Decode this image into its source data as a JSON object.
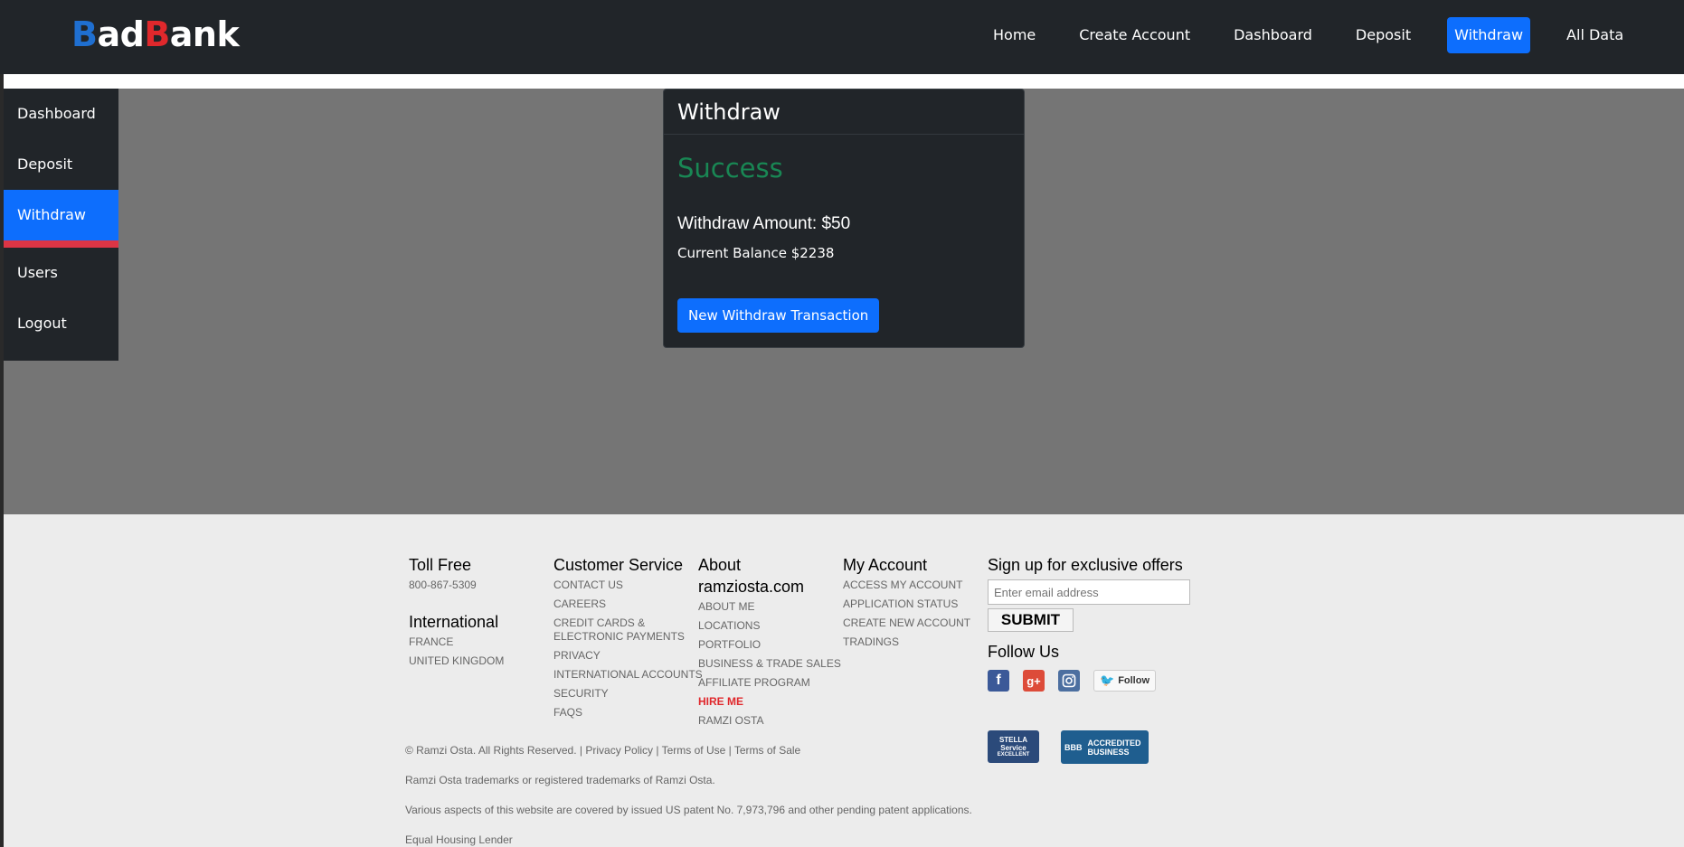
{
  "navbar": {
    "brand": {
      "part1": "B",
      "part2": "ad",
      "part3": "B",
      "part4": "ank"
    },
    "links": [
      "Home",
      "Create Account",
      "Dashboard",
      "Deposit",
      "Withdraw",
      "All Data"
    ],
    "active": "Withdraw"
  },
  "sidebar": {
    "items": [
      "Dashboard",
      "Deposit",
      "Withdraw",
      "Users",
      "Logout"
    ],
    "active": "Withdraw"
  },
  "card": {
    "title": "Withdraw",
    "status": "Success",
    "amount_text": "Withdraw Amount: $50",
    "balance_text": "Current Balance $2238",
    "button": "New Withdraw Transaction"
  },
  "footer": {
    "toll_free": {
      "heading": "Toll Free",
      "phone": "800-867-5309"
    },
    "international": {
      "heading": "International",
      "links": [
        "FRANCE",
        "UNITED KINGDOM"
      ]
    },
    "customer_service": {
      "heading": "Customer Service",
      "links": [
        "CONTACT US",
        "CAREERS",
        "CREDIT CARDS &",
        "ELECTRONIC PAYMENTS",
        "PRIVACY",
        "INTERNATIONAL ACCOUNTS",
        "SECURITY",
        "FAQS"
      ]
    },
    "about": {
      "heading_line1": "About",
      "heading_line2": "ramziosta.com",
      "links": [
        "ABOUT ME",
        "LOCATIONS",
        "PORTFOLIO",
        "BUSINESS & TRADE SALES",
        "AFFILIATE PROGRAM",
        "HIRE ME",
        "RAMZI OSTA"
      ]
    },
    "my_account": {
      "heading": "My Account",
      "links": [
        "ACCESS MY ACCOUNT",
        "APPLICATION STATUS",
        "CREATE NEW ACCOUNT",
        "TRADINGS"
      ]
    },
    "signup": {
      "heading": "Sign up for exclusive offers",
      "placeholder": "Enter email address",
      "submit": "SUBMIT",
      "follow_heading": "Follow Us",
      "twitter_follow": "Follow"
    },
    "legal": {
      "copyright": "© Ramzi Osta. All Rights Reserved. | Privacy Policy | Terms of Use | Terms of Sale",
      "trademark": "Ramzi Osta trademarks or registered trademarks of Ramzi Osta.",
      "patent": "Various aspects of this website are covered by issued US patent No. 7,973,796 and other pending patent applications.",
      "lender": "Equal Housing Lender"
    },
    "badges": {
      "stella_line1": "STELLA",
      "stella_line2": "Service",
      "stella_line3": "EXCELLENT",
      "bbb_logo": "BBB",
      "bbb_line1": "ACCREDITED",
      "bbb_line2": "BUSINESS"
    }
  }
}
